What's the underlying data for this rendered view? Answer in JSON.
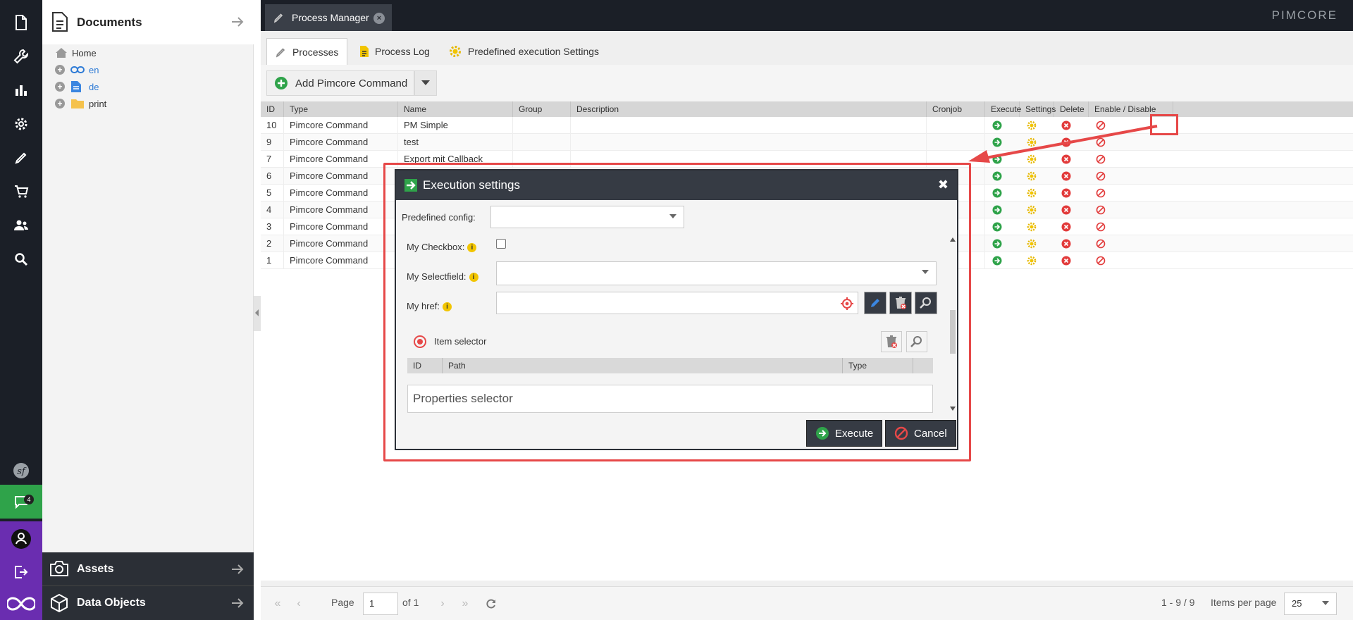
{
  "tree": {
    "title": "Documents",
    "nodes": [
      {
        "label": "Home"
      },
      {
        "label": "en"
      },
      {
        "label": "de"
      },
      {
        "label": "print"
      }
    ],
    "accordion": [
      {
        "label": "Assets"
      },
      {
        "label": "Data Objects"
      }
    ]
  },
  "sidebar": {
    "notification_count": "4"
  },
  "header": {
    "tab_title": "Process Manager",
    "brand": "PIMCORE"
  },
  "subtabs": [
    {
      "label": "Processes"
    },
    {
      "label": "Process Log"
    },
    {
      "label": "Predefined execution Settings"
    }
  ],
  "toolbar": {
    "add_label": "Add Pimcore Command"
  },
  "grid": {
    "columns": [
      "ID",
      "Type",
      "Name",
      "Group",
      "Description",
      "Cronjob",
      "Execute",
      "Settings",
      "Delete",
      "Enable / Disable"
    ],
    "rows": [
      {
        "id": "10",
        "type": "Pimcore Command",
        "name": "PM Simple"
      },
      {
        "id": "9",
        "type": "Pimcore Command",
        "name": "test"
      },
      {
        "id": "7",
        "type": "Pimcore Command",
        "name": "Export mit Callback"
      },
      {
        "id": "6",
        "type": "Pimcore Command",
        "name": ""
      },
      {
        "id": "5",
        "type": "Pimcore Command",
        "name": ""
      },
      {
        "id": "4",
        "type": "Pimcore Command",
        "name": ""
      },
      {
        "id": "3",
        "type": "Pimcore Command",
        "name": ""
      },
      {
        "id": "2",
        "type": "Pimcore Command",
        "name": ""
      },
      {
        "id": "1",
        "type": "Pimcore Command",
        "name": ""
      }
    ]
  },
  "pager": {
    "page_label": "Page",
    "page_value": "1",
    "of_label": "of 1",
    "range": "1 - 9 / 9",
    "items_per_page_label": "Items per page",
    "items_per_page_value": "25"
  },
  "dialog": {
    "title": "Execution settings",
    "predefined_label": "Predefined config:",
    "predefined_value": "",
    "checkbox_label": "My Checkbox:",
    "select_label": "My Selectfield:",
    "select_value": "",
    "href_label": "My href:",
    "href_value": "",
    "item_selector_label": "Item selector",
    "item_columns": [
      "ID",
      "Path",
      "Type"
    ],
    "properties_label": "Properties selector",
    "execute_label": "Execute",
    "cancel_label": "Cancel"
  },
  "colors": {
    "accent_red": "#e64848",
    "dark": "#1b1f27",
    "green": "#2fa34a",
    "purple": "#6a2db0"
  }
}
